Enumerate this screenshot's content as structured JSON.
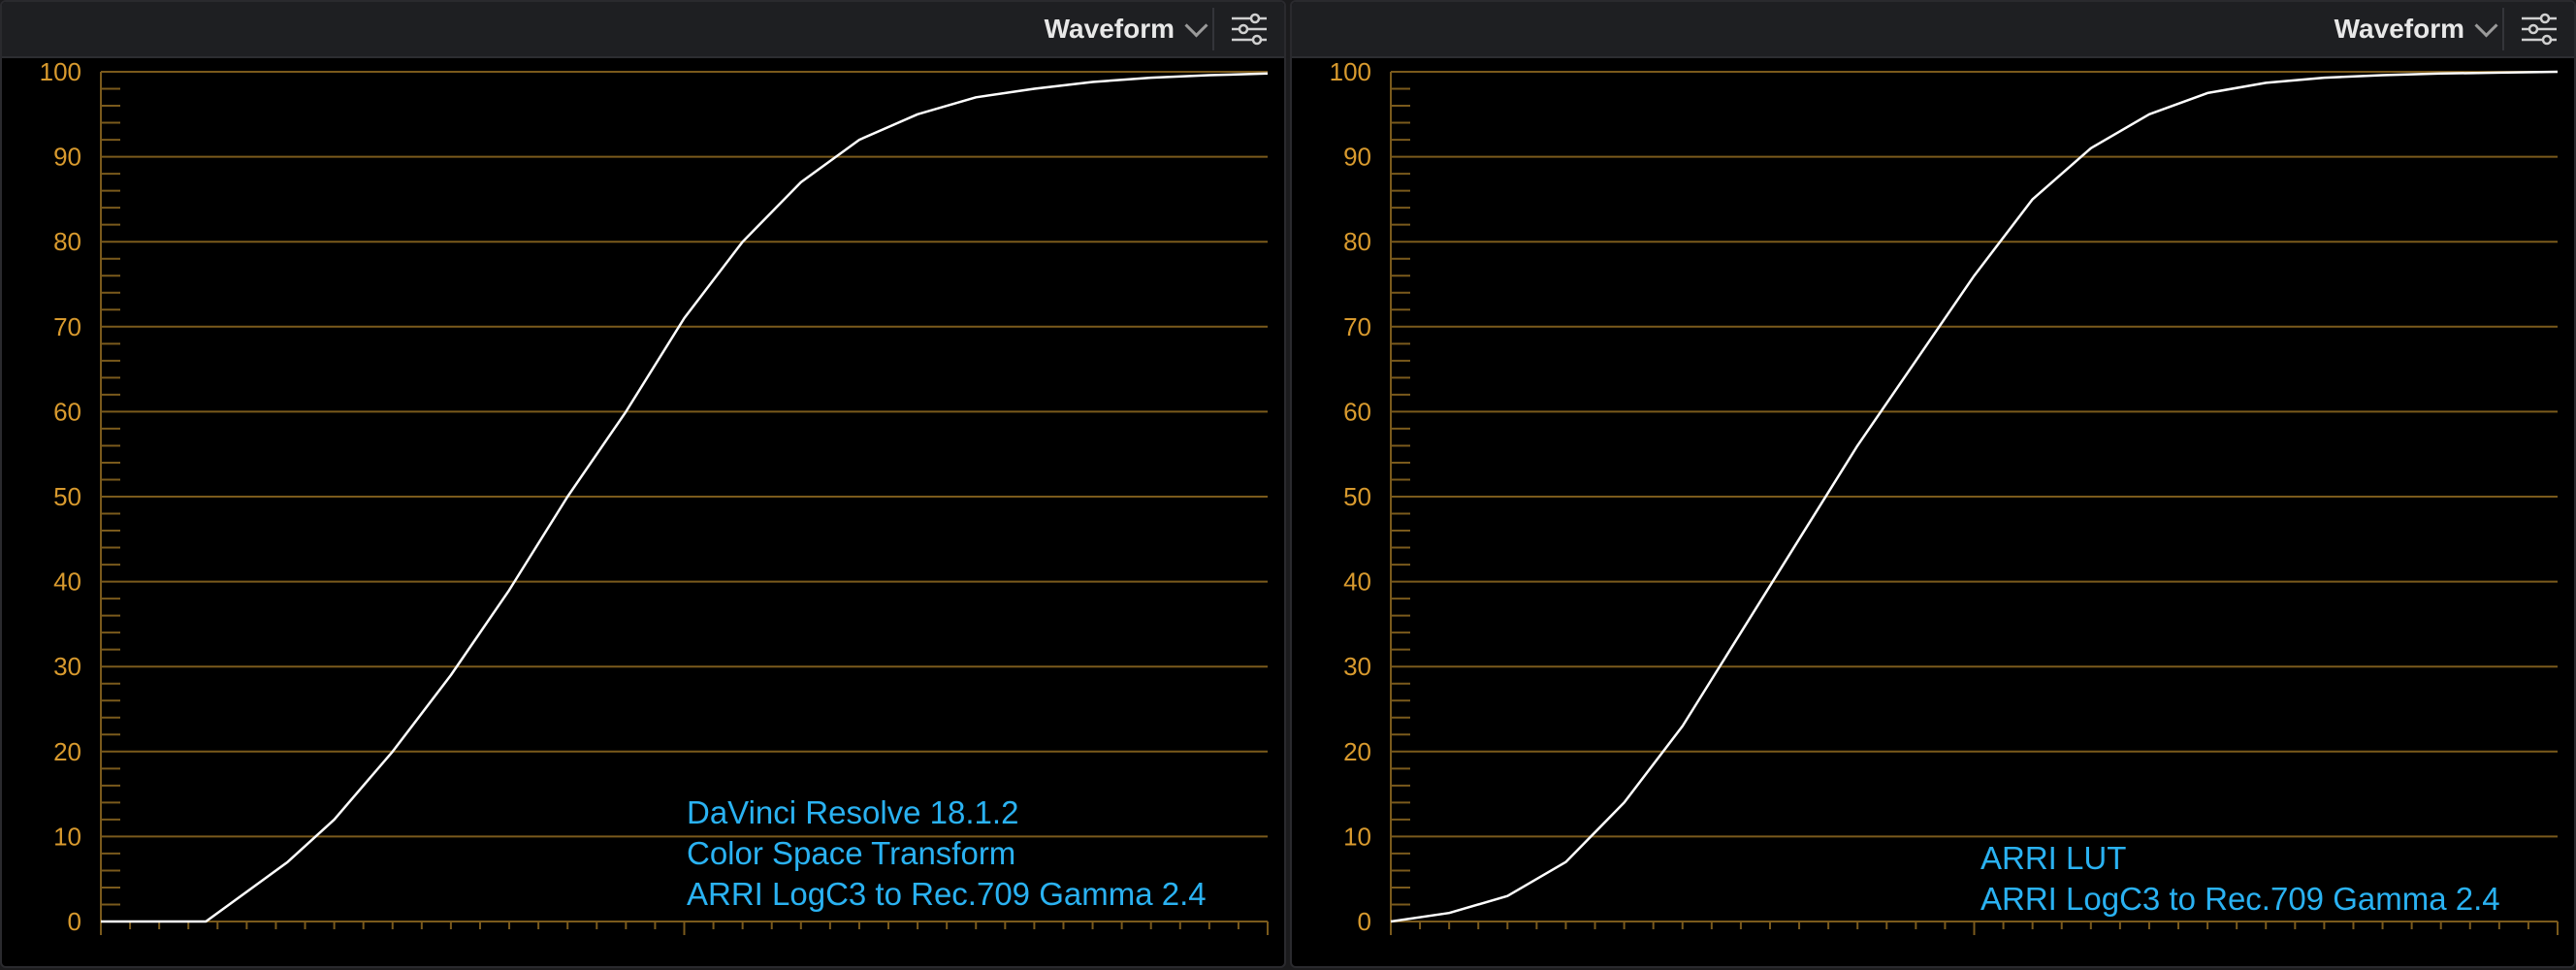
{
  "colors": {
    "background": "#000000",
    "header_bg": "#1e1f22",
    "graticule": "#7a5a1c",
    "tick_label": "#d89a2e",
    "trace": "#ffffff",
    "annotation": "#2ab2f2"
  },
  "panels": [
    {
      "scope_type": "Waveform",
      "settings_icon": "sliders-icon",
      "dropdown_icon": "chevron-down-icon",
      "annotation": [
        "DaVinci Resolve 18.1.2",
        "Color Space Transform",
        "ARRI LogC3 to Rec.709 Gamma 2.4"
      ]
    },
    {
      "scope_type": "Waveform",
      "settings_icon": "sliders-icon",
      "dropdown_icon": "chevron-down-icon",
      "annotation": [
        "ARRI LUT",
        "ARRI LogC3 to Rec.709 Gamma 2.4"
      ]
    }
  ],
  "chart_data": [
    {
      "type": "line",
      "yticks": [
        0,
        10,
        20,
        30,
        40,
        50,
        60,
        70,
        80,
        90,
        100
      ],
      "ylim": [
        0,
        100
      ],
      "xlim": [
        0,
        100
      ],
      "series": [
        {
          "x": [
            0,
            9,
            10,
            13,
            16,
            20,
            25,
            30,
            35,
            40,
            45,
            50,
            55,
            60,
            65,
            70,
            75,
            80,
            85,
            90,
            95,
            100
          ],
          "values": [
            0,
            0,
            1,
            4,
            7,
            12,
            20,
            29,
            39,
            50,
            60,
            71,
            80,
            87,
            92,
            95,
            97,
            98,
            98.8,
            99.3,
            99.6,
            99.8
          ]
        }
      ]
    },
    {
      "type": "line",
      "yticks": [
        0,
        10,
        20,
        30,
        40,
        50,
        60,
        70,
        80,
        90,
        100
      ],
      "ylim": [
        0,
        100
      ],
      "xlim": [
        0,
        100
      ],
      "series": [
        {
          "x": [
            0,
            5,
            10,
            15,
            20,
            25,
            30,
            35,
            40,
            45,
            50,
            55,
            60,
            65,
            70,
            75,
            80,
            85,
            90,
            95,
            100
          ],
          "values": [
            0,
            1,
            3,
            7,
            14,
            23,
            34,
            45,
            56,
            66,
            76,
            85,
            91,
            95,
            97.5,
            98.7,
            99.3,
            99.6,
            99.8,
            99.9,
            100
          ]
        }
      ]
    }
  ]
}
